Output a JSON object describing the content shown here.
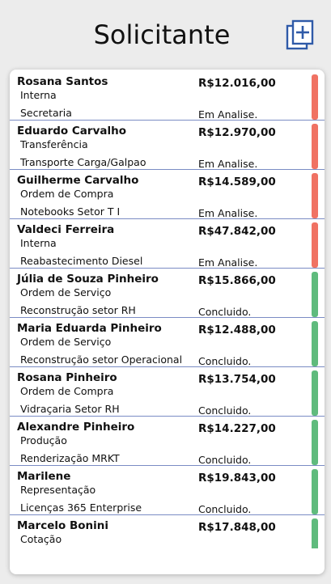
{
  "header": {
    "title": "Solicitante",
    "add_icon": "add-document-icon",
    "accent": "#2f5aa8"
  },
  "status_colors": {
    "em_analise": "#f07263",
    "concluido": "#5fbb7d"
  },
  "requests": [
    {
      "name": "Rosana Santos",
      "type": "Interna",
      "description": "Secretaria",
      "value": "R$12.016,00",
      "status": "Em Analise.",
      "status_color": "#f07263"
    },
    {
      "name": "Eduardo Carvalho",
      "type": "Transferência",
      "description": "Transporte Carga/Galpao",
      "value": "R$12.970,00",
      "status": "Em Analise.",
      "status_color": "#f07263"
    },
    {
      "name": "Guilherme Carvalho",
      "type": "Ordem de Compra",
      "description": "Notebooks Setor T I",
      "value": "R$14.589,00",
      "status": "Em Analise.",
      "status_color": "#f07263"
    },
    {
      "name": "Valdeci Ferreira",
      "type": "Interna",
      "description": "Reabastecimento Diesel",
      "value": "R$47.842,00",
      "status": "Em Analise.",
      "status_color": "#f07263"
    },
    {
      "name": "Júlia de Souza Pinheiro",
      "type": "Ordem de Serviço",
      "description": "Reconstrução setor RH",
      "value": "R$15.866,00",
      "status": "Concluido.",
      "status_color": "#5fbb7d"
    },
    {
      "name": "Maria Eduarda Pinheiro",
      "type": "Ordem de Serviço",
      "description": "Reconstrução setor Operacional",
      "value": "R$12.488,00",
      "status": "Concluido.",
      "status_color": "#5fbb7d"
    },
    {
      "name": "Rosana Pinheiro",
      "type": "Ordem de Compra",
      "description": "Vidraçaria Setor RH",
      "value": "R$13.754,00",
      "status": "Concluido.",
      "status_color": "#5fbb7d"
    },
    {
      "name": "Alexandre Pinheiro",
      "type": "Produção",
      "description": "Renderização MRKT",
      "value": "R$14.227,00",
      "status": "Concluido.",
      "status_color": "#5fbb7d"
    },
    {
      "name": "Marilene",
      "type": "Representação",
      "description": "Licenças 365 Enterprise",
      "value": "R$19.843,00",
      "status": "Concluido.",
      "status_color": "#5fbb7d"
    },
    {
      "name": "Marcelo Bonini",
      "type": "Cotação",
      "description": "",
      "value": "R$17.848,00",
      "status": "",
      "status_color": "#5fbb7d"
    }
  ]
}
